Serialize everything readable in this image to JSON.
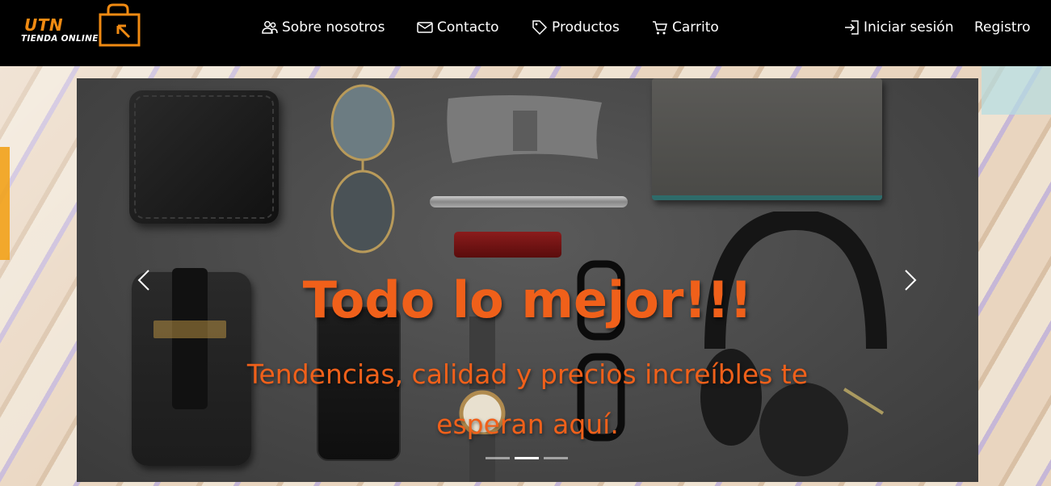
{
  "brand": {
    "name": "UTN",
    "tagline": "TIENDA ONLINE"
  },
  "nav": {
    "about": "Sobre nosotros",
    "contact": "Contacto",
    "products": "Productos",
    "cart": "Carrito",
    "login": "Iniciar sesión",
    "register": "Registro"
  },
  "carousel": {
    "title": "Todo lo mejor!!!",
    "subtitle": "Tendencias, calidad y precios increíbles te esperan aquí.",
    "slides": 3,
    "active_slide": 2
  },
  "colors": {
    "accent": "#f0601a",
    "logo": "#f08a12",
    "navbar": "#000000"
  }
}
